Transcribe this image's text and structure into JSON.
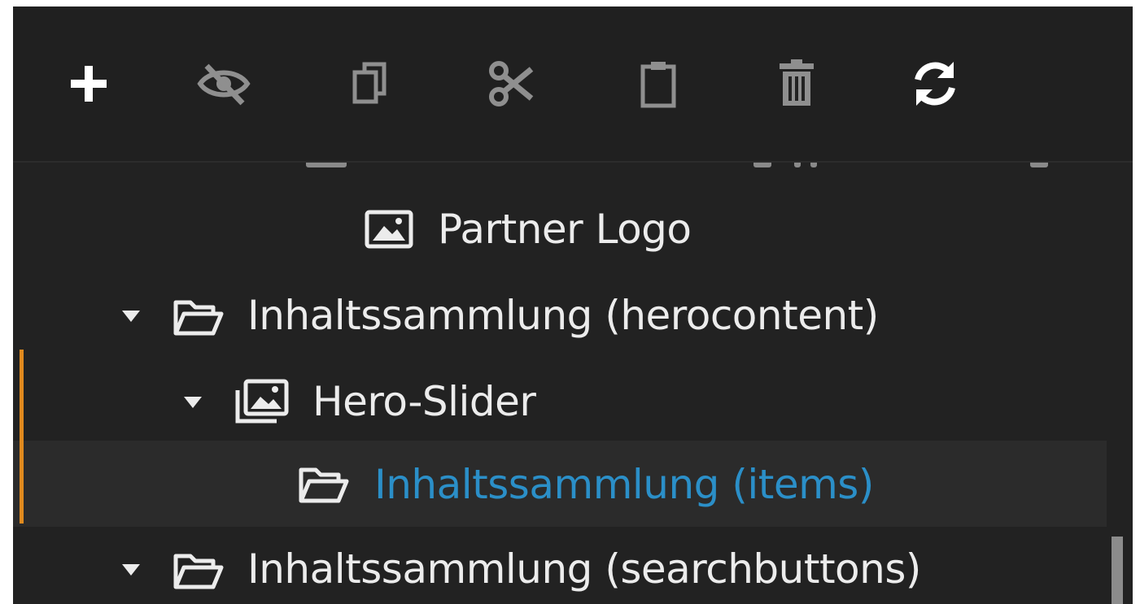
{
  "toolbar": {
    "buttons": [
      {
        "name": "add",
        "icon": "plus-icon"
      },
      {
        "name": "hide",
        "icon": "eye-slash-icon"
      },
      {
        "name": "copy",
        "icon": "copy-icon"
      },
      {
        "name": "cut",
        "icon": "scissors-icon"
      },
      {
        "name": "paste",
        "icon": "clipboard-icon"
      },
      {
        "name": "delete",
        "icon": "trash-icon"
      },
      {
        "name": "refresh",
        "icon": "refresh-icon"
      }
    ]
  },
  "tree": {
    "items": [
      {
        "label": "Partner Logo",
        "icon": "image-icon",
        "expanded": null,
        "selected": false
      },
      {
        "label": "Inhaltssammlung (herocontent)",
        "icon": "folder-open-icon",
        "expanded": true,
        "selected": false
      },
      {
        "label": "Hero-Slider",
        "icon": "images-icon",
        "expanded": true,
        "selected": false
      },
      {
        "label": "Inhaltssammlung (items)",
        "icon": "folder-open-icon",
        "expanded": null,
        "selected": true
      },
      {
        "label": "Inhaltssammlung (searchbuttons)",
        "icon": "folder-open-icon",
        "expanded": true,
        "selected": false
      }
    ]
  },
  "colors": {
    "panel_bg": "#222222",
    "text": "#ececec",
    "selected_text": "#2b8fc8",
    "accent": "#e08a1e",
    "disabled_icon": "#8f8f8f"
  }
}
